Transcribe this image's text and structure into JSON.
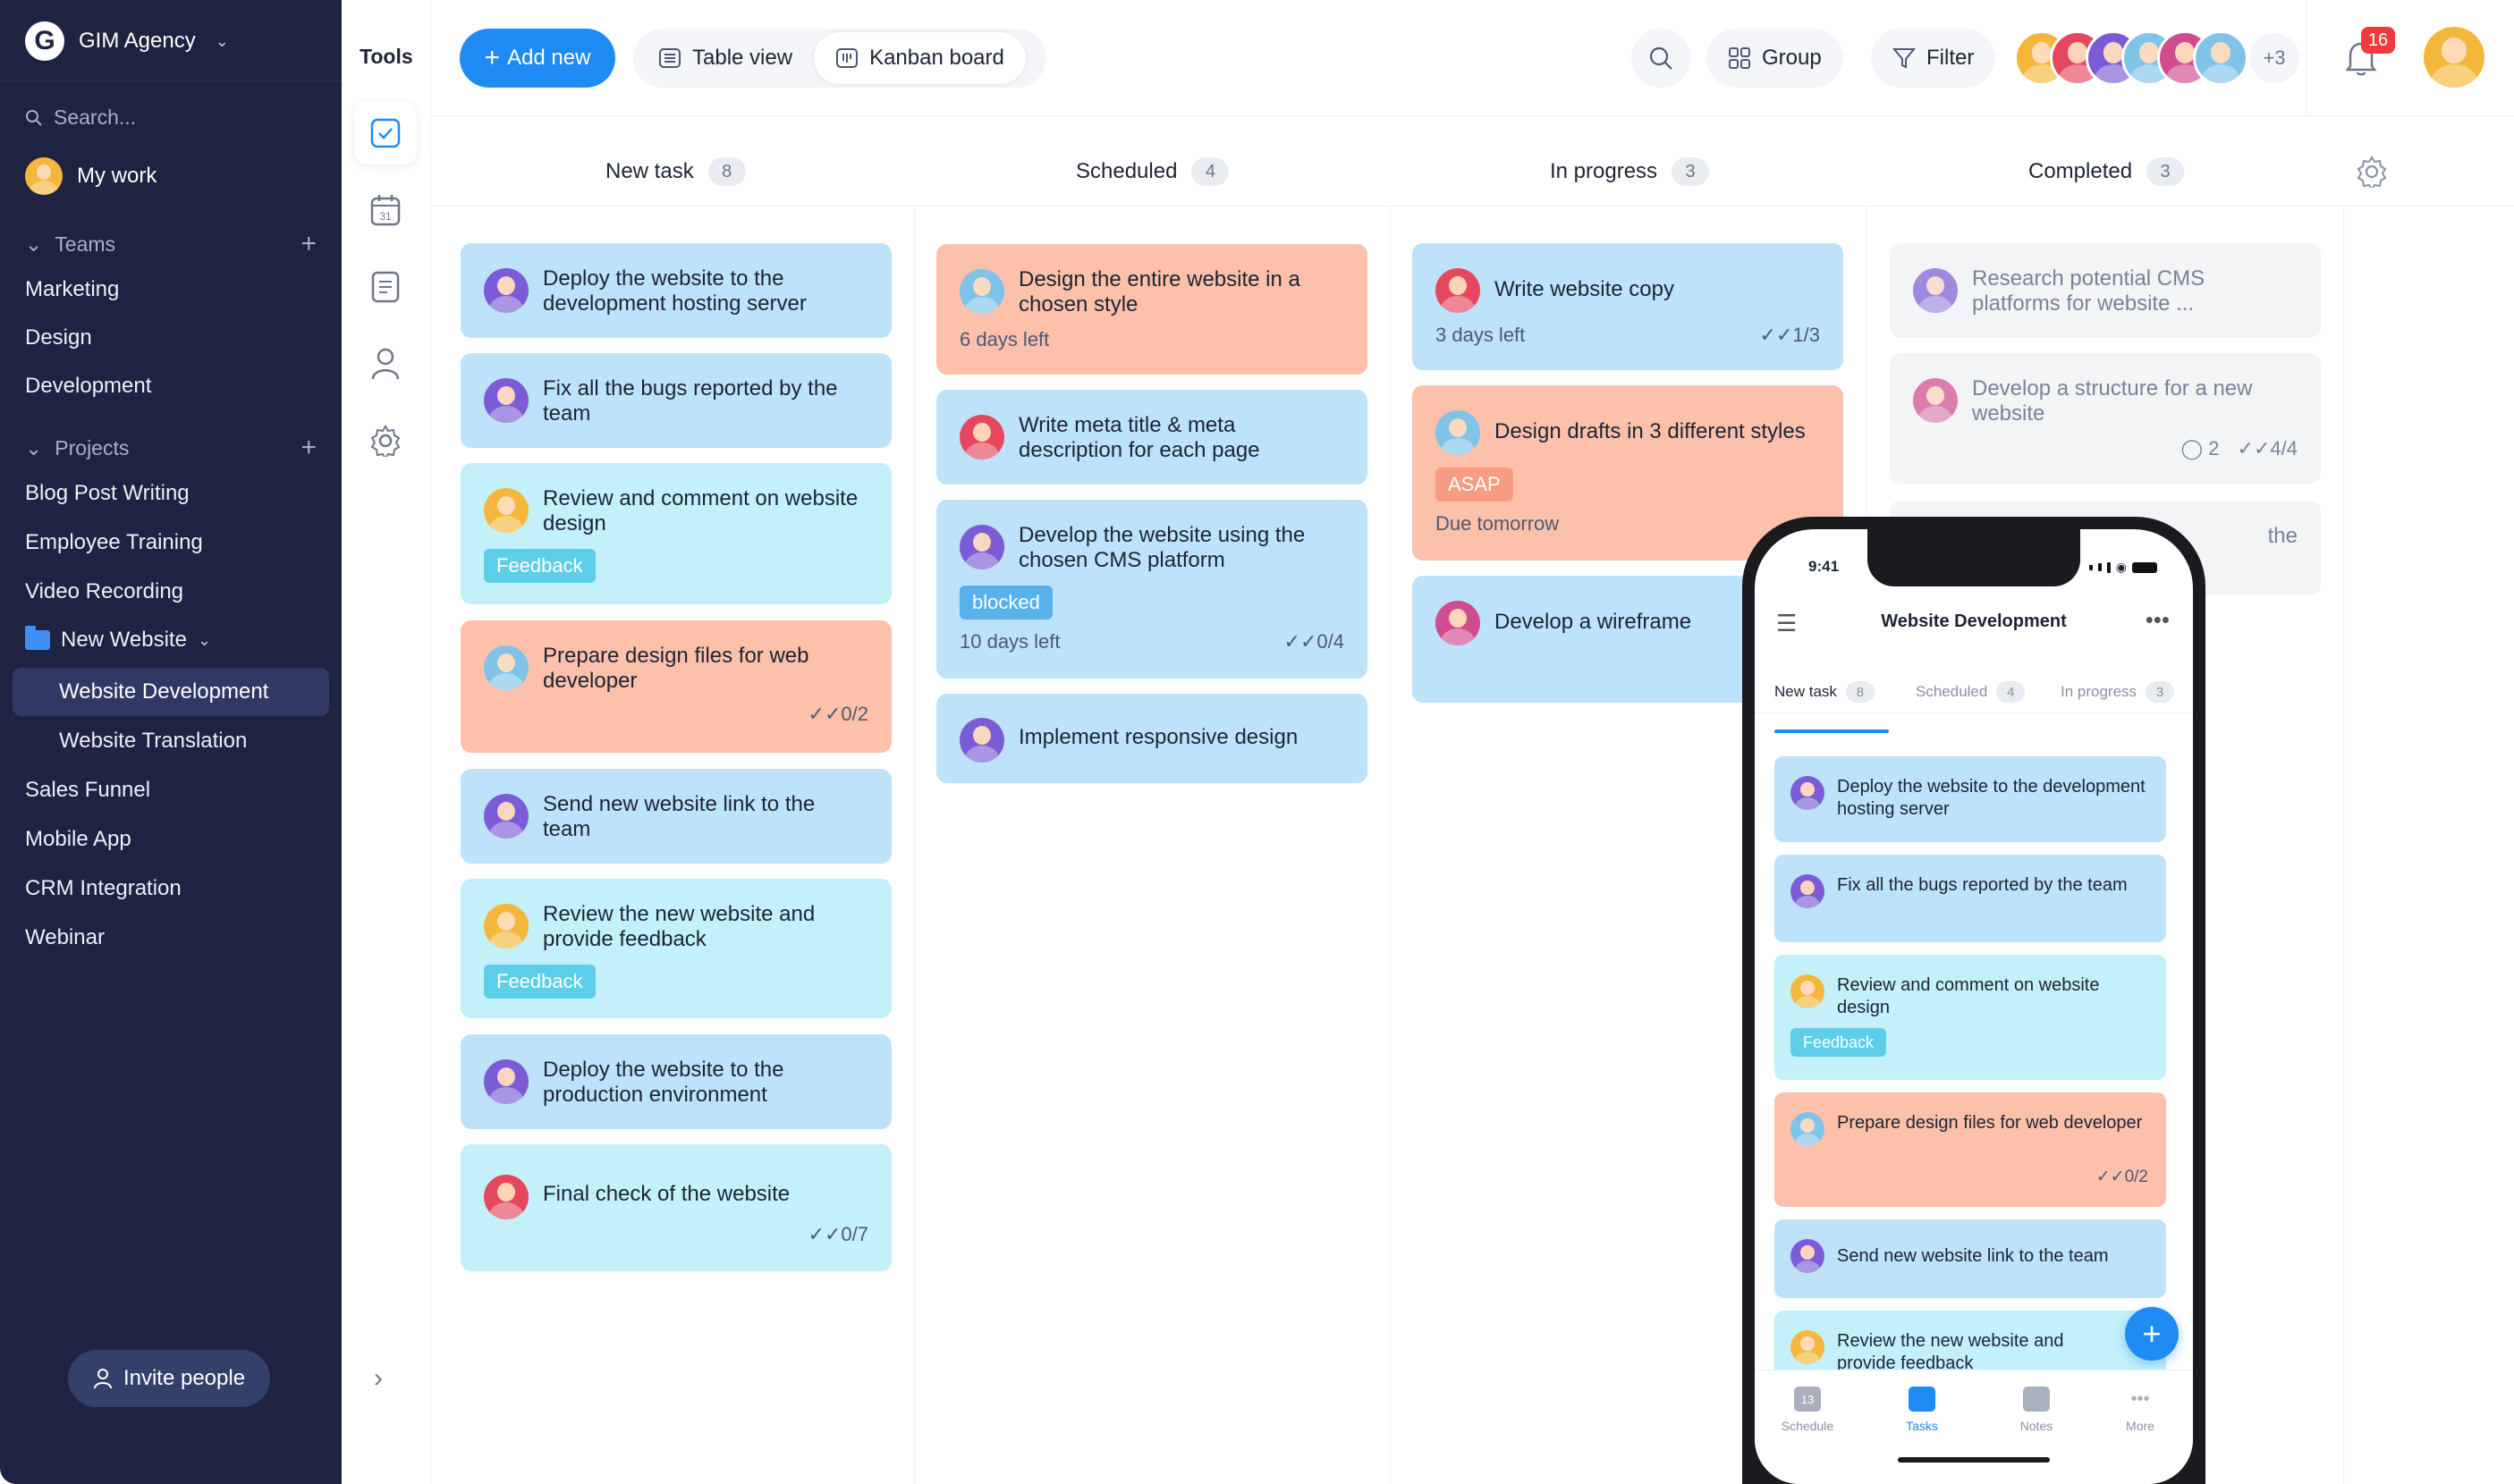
{
  "colors": {
    "sidebar": "#1d2340",
    "accent": "#1e8bf5",
    "card_blue": "#bde2fa",
    "card_cyan": "#c3f0f9",
    "card_salmon": "#fcc0ab",
    "card_grey": "#f2f4f6",
    "badge": "#ef3b3b"
  },
  "sidebar": {
    "workspace": "GIM Agency",
    "search_placeholder": "Search...",
    "my_work": "My work",
    "teams_label": "Teams",
    "teams": [
      "Marketing",
      "Design",
      "Development"
    ],
    "projects_label": "Projects",
    "projects": [
      "Blog Post Writing",
      "Employee Training",
      "Video Recording"
    ],
    "folder": "New Website",
    "folder_items": [
      "Website Development",
      "Website Translation"
    ],
    "projects_more": [
      "Sales Funnel",
      "Mobile App",
      "CRM Integration",
      "Webinar"
    ],
    "invite": "Invite people"
  },
  "tools": {
    "title": "Tools",
    "icons": [
      "tasks-check-icon",
      "calendar-icon",
      "notes-icon",
      "user-icon",
      "settings-gear-icon"
    ],
    "calendar_day": "31"
  },
  "header": {
    "add_new": "Add new",
    "views": [
      "Table view",
      "Kanban board"
    ],
    "group": "Group",
    "filter": "Filter",
    "more_members": "+3",
    "notifications": "16"
  },
  "columns": [
    {
      "name": "New task",
      "count": "8"
    },
    {
      "name": "Scheduled",
      "count": "4"
    },
    {
      "name": "In progress",
      "count": "3"
    },
    {
      "name": "Completed",
      "count": "3"
    }
  ],
  "cards": {
    "new_task": [
      {
        "title": "Deploy the website to the development hosting server"
      },
      {
        "title": "Fix all the bugs reported by the team"
      },
      {
        "title": "Review and comment on website design",
        "tag": "Feedback"
      },
      {
        "title": "Prepare design files for web developer",
        "check": "0/2"
      },
      {
        "title": "Send new website link to the team"
      },
      {
        "title": "Review the new website and provide feedback",
        "tag": "Feedback"
      },
      {
        "title": "Deploy the website to the production environment"
      },
      {
        "title": "Final check of the website",
        "check": "0/7"
      }
    ],
    "scheduled": [
      {
        "title": "Design the entire website in a chosen style",
        "due": "6 days left"
      },
      {
        "title": "Write meta title & meta description for each page"
      },
      {
        "title": "Develop the website using the chosen CMS platform",
        "tag": "blocked",
        "due": "10 days left",
        "check": "0/4"
      },
      {
        "title": "Implement responsive design"
      }
    ],
    "in_progress": [
      {
        "title": "Write website copy",
        "due": "3 days left",
        "check": "1/3"
      },
      {
        "title": "Design drafts in 3 different styles",
        "tag": "ASAP",
        "due": "Due tomorrow"
      },
      {
        "title": "Develop a wireframe"
      }
    ],
    "completed": [
      {
        "title": "Research potential CMS platforms for website ..."
      },
      {
        "title": "Develop a structure for a new website",
        "comments": "2",
        "check": "4/4"
      },
      {
        "title": "the"
      }
    ]
  },
  "phone": {
    "time": "9:41",
    "title": "Website Development",
    "tabs": [
      {
        "name": "New task",
        "count": "8"
      },
      {
        "name": "Scheduled",
        "count": "4"
      },
      {
        "name": "In progress",
        "count": "3"
      }
    ],
    "cards": [
      {
        "title": "Deploy the website to the development hosting server"
      },
      {
        "title": "Fix all the bugs reported by the team"
      },
      {
        "title": "Review and comment on website design",
        "tag": "Feedback"
      },
      {
        "title": "Prepare design files for web developer",
        "check": "0/2"
      },
      {
        "title": "Send new website link to the team"
      },
      {
        "title": "Review the new website and provide feedback"
      }
    ],
    "nav": [
      "Schedule",
      "Tasks",
      "Notes",
      "More"
    ],
    "nav_day": "13"
  }
}
